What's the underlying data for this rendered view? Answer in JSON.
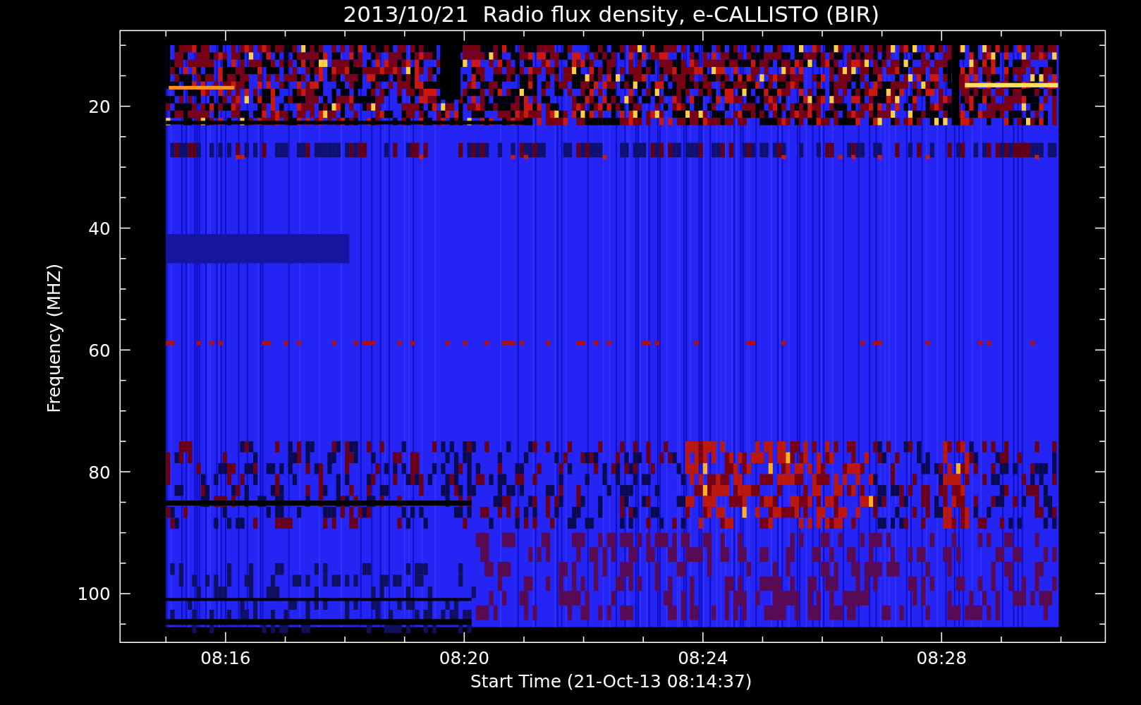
{
  "title": "2013/10/21  Radio flux density, e-CALLISTO (BIR)",
  "y_axis": {
    "label": "Frequency (MHZ)",
    "ticks": [
      "20",
      "40",
      "60",
      "80",
      "100"
    ]
  },
  "x_axis": {
    "label": "Start Time (21-Oct-13 08:14:37)",
    "ticks": [
      "08:16",
      "08:20",
      "08:24",
      "08:28"
    ]
  }
}
